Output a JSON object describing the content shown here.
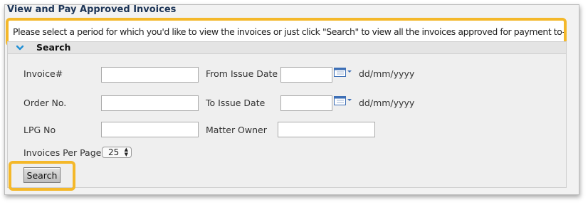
{
  "panel": {
    "title": "View and Pay Approved Invoices",
    "instructions": "Please select a period for which you'd like to view the invoices or just click \"Search\" to view all the invoices approved for payment to-date"
  },
  "search_section": {
    "title": "Search",
    "chevron_icon": "chevron-down-icon",
    "fields": {
      "invoice_label": "Invoice#",
      "invoice_value": "",
      "order_label": "Order No.",
      "order_value": "",
      "lpg_label": "LPG No",
      "lpg_value": "",
      "from_date_label": "From Issue Date",
      "from_date_value": "",
      "to_date_label": "To Issue Date",
      "to_date_value": "",
      "date_format_hint": "dd/mm/yyyy",
      "matter_owner_label": "Matter Owner",
      "matter_owner_value": "",
      "per_page_label": "Invoices Per Page",
      "per_page_value": "25"
    },
    "calendar_icon": "calendar-icon",
    "search_button_label": "Search"
  },
  "colors": {
    "title_text": "#1d3557",
    "highlight": "#f4b82a",
    "chevron": "#1e8fd6",
    "calendar": "#3d6fb6"
  }
}
